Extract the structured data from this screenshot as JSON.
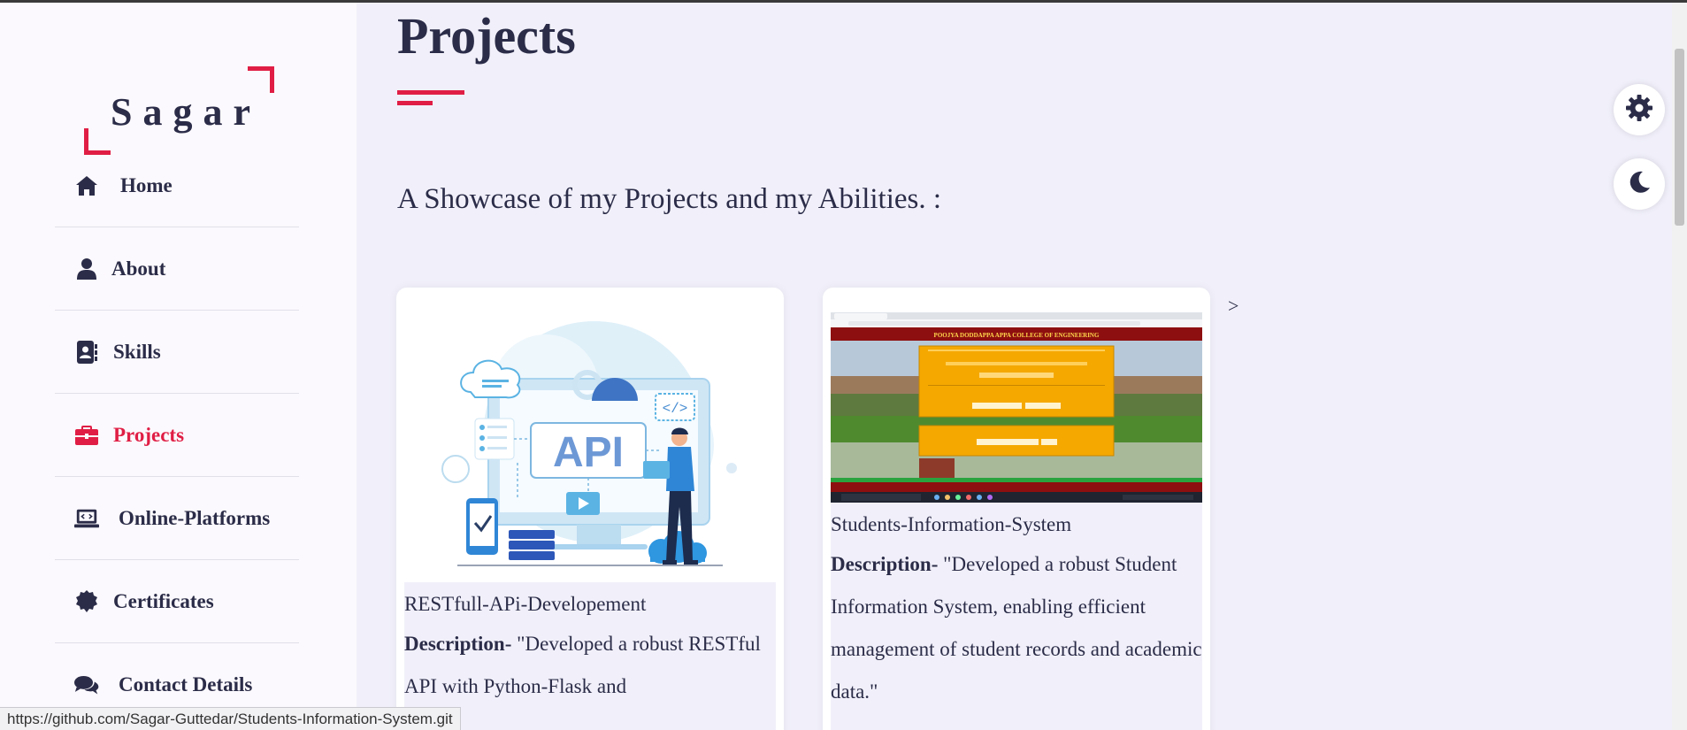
{
  "sidebar": {
    "logo": "Sagar",
    "items": [
      {
        "label": "Home",
        "icon": "home-icon"
      },
      {
        "label": "About",
        "icon": "user-icon"
      },
      {
        "label": "Skills",
        "icon": "address-book-icon"
      },
      {
        "label": "Projects",
        "icon": "briefcase-icon",
        "active": true
      },
      {
        "label": "Online-Platforms",
        "icon": "laptop-code-icon"
      },
      {
        "label": "Certificates",
        "icon": "certificate-icon"
      },
      {
        "label": "Contact Details",
        "icon": "comments-icon"
      }
    ]
  },
  "main": {
    "title": "Projects",
    "subtitle": "A Showcase of my Projects and my Abilities. :",
    "projects": [
      {
        "name": "RESTfull-APi-Developement",
        "desc_label": "Description-",
        "desc_text": " \"Developed a robust RESTful API with Python-Flask and",
        "image": "api-illustration",
        "image_text": "API"
      },
      {
        "name": "Students-Information-System",
        "desc_label": "Description-",
        "desc_text": " \"Developed a robust Student Information System, enabling efficient management of student records and academic data.\"",
        "image": "students-info-system-screenshot",
        "image_header": "POOJYA DODDAPPA APPA COLLEGE OF ENGINEERING"
      }
    ],
    "next_arrow": ">"
  },
  "controls": {
    "settings_icon": "gear-icon",
    "theme_icon": "moon-icon"
  },
  "status_url": "https://github.com/Sagar-Guttedar/Students-Information-System.git",
  "colors": {
    "accent": "#e01e45",
    "text": "#2b2c48",
    "bg": "#f1f0fa",
    "sidebar_bg": "#fbf9fd"
  }
}
